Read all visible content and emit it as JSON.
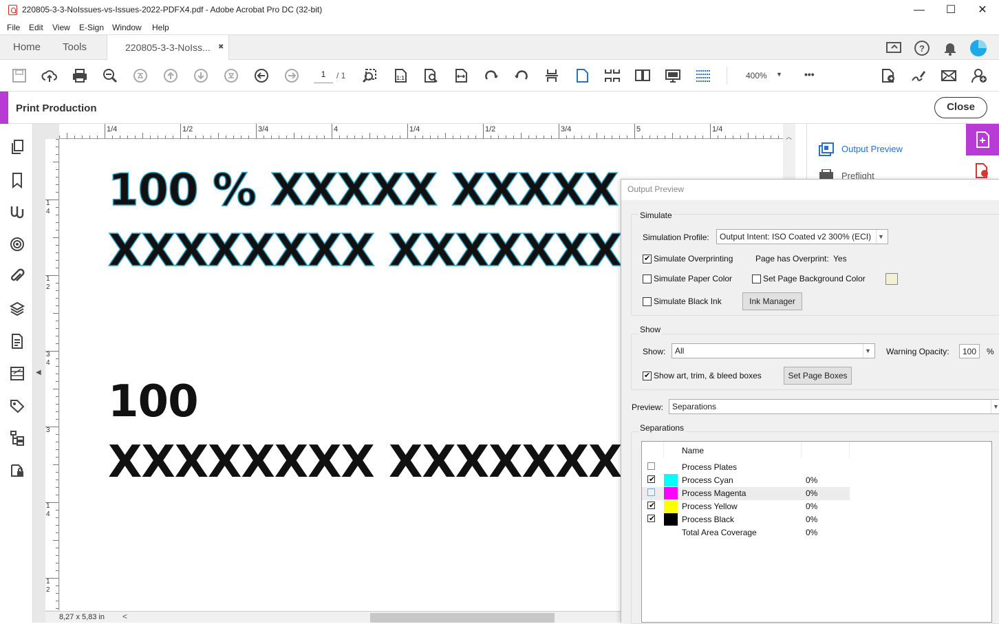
{
  "window": {
    "title": "220805-3-3-NoIssues-vs-Issues-2022-PDFX4.pdf - Adobe Acrobat Pro DC (32-bit)",
    "minimize": "—",
    "maximize": "☐",
    "close": "✕"
  },
  "menu": [
    "File",
    "Edit",
    "View",
    "E-Sign",
    "Window",
    "Help"
  ],
  "tabs": {
    "home": "Home",
    "tools": "Tools",
    "doc": "220805-3-3-NoIss...",
    "doc_close": "✖"
  },
  "toolbar": {
    "page_current": "1",
    "page_total": "/ 1",
    "zoom": "400%",
    "more": "•••"
  },
  "print_production": {
    "label": "Print Production",
    "close": "Close"
  },
  "rulers": {
    "h_ticks": [
      "1/4",
      "1/2",
      "3/4",
      "4",
      "1/4",
      "1/2",
      "3/4",
      "5",
      "1/4"
    ],
    "v_ticks": [
      "1",
      "4",
      "1",
      "2",
      "3",
      "4",
      "3",
      "1",
      "4",
      "1",
      "2"
    ]
  },
  "page_content": {
    "line1": "100 % XXXXX XXXXX",
    "line2": "XXXXXXXX XXXXXXX",
    "line3": "100",
    "line4": "XXXXXXXX XXXXXXX"
  },
  "status": {
    "dimensions": "8,27 x 5,83 in",
    "scroll_left": "<"
  },
  "right_panel": {
    "output_preview": "Output Preview",
    "preflight": "Preflight"
  },
  "dialog": {
    "title": "Output Preview",
    "simulate": {
      "group": "Simulate",
      "profile_label": "Simulation Profile:",
      "profile_value": "Output Intent: ISO Coated v2 300% (ECI)",
      "overprinting": "Simulate Overprinting",
      "page_overprint_label": "Page has Overprint:",
      "page_overprint_value": "Yes",
      "paper_color": "Simulate Paper Color",
      "bg_color": "Set Page Background Color",
      "black_ink": "Simulate Black Ink",
      "ink_manager": "Ink Manager"
    },
    "show": {
      "group": "Show",
      "show_label": "Show:",
      "show_value": "All",
      "warning_label": "Warning Opacity:",
      "warning_value": "100",
      "percent": "%",
      "boxes": "Show art, trim, & bleed boxes",
      "set_boxes": "Set Page Boxes"
    },
    "preview_label": "Preview:",
    "preview_value": "Separations",
    "separations": {
      "group": "Separations",
      "col_name": "Name",
      "rows": [
        {
          "name": "Process Plates",
          "value": "",
          "color": "",
          "checked": false
        },
        {
          "name": "Process Cyan",
          "value": "0%",
          "color": "#00ffff",
          "checked": true
        },
        {
          "name": "Process Magenta",
          "value": "0%",
          "color": "#ff00ff",
          "checked": false
        },
        {
          "name": "Process Yellow",
          "value": "0%",
          "color": "#ffff00",
          "checked": true
        },
        {
          "name": "Process Black",
          "value": "0%",
          "color": "#000000",
          "checked": true
        },
        {
          "name": "Total Area Coverage",
          "value": "0%",
          "color": "",
          "checked": false
        }
      ]
    }
  },
  "colors": {
    "accent": "#b83bd6",
    "outline": "#27a3c9",
    "link": "#2a6fcf"
  }
}
